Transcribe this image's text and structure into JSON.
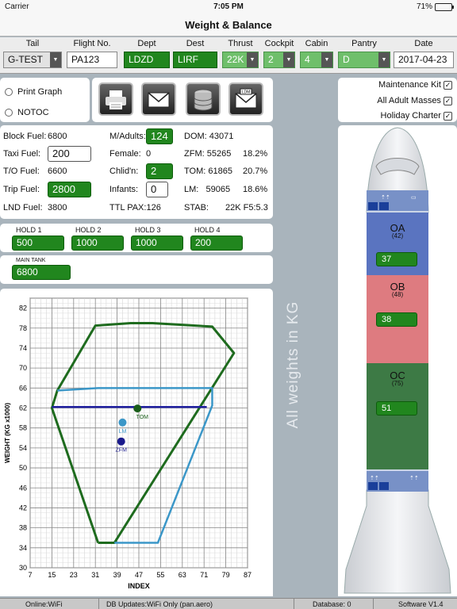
{
  "status": {
    "carrier": "Carrier",
    "time": "7:05 PM",
    "battery": "71%"
  },
  "nav": {
    "title": "Weight & Balance"
  },
  "fields": [
    {
      "label": "Tail",
      "value": "G-TEST"
    },
    {
      "label": "Flight No.",
      "value": "PA123"
    },
    {
      "label": "Dept",
      "value": "LDZD"
    },
    {
      "label": "Dest",
      "value": "LIRF"
    },
    {
      "label": "Thrust",
      "value": "22K"
    },
    {
      "label": "Cockpit",
      "value": "2"
    },
    {
      "label": "Cabin",
      "value": "4"
    },
    {
      "label": "Pantry",
      "value": "D"
    },
    {
      "label": "Date",
      "value": "2017-04-23"
    }
  ],
  "options": {
    "print_graph": "Print Graph",
    "notoc": "NOTOC"
  },
  "side_options": [
    {
      "label": "Maintenance Kit",
      "checked": true
    },
    {
      "label": "All Adult Masses",
      "checked": true
    },
    {
      "label": "Holiday Charter",
      "checked": true
    }
  ],
  "toolbar": {
    "ldm_label": "LDM"
  },
  "fuel": {
    "block_label": "Block Fuel:",
    "block_value": "6800",
    "taxi_label": "Taxi Fuel:",
    "taxi_value": "200",
    "to_label": "T/O Fuel:",
    "to_value": "6600",
    "trip_label": "Trip Fuel:",
    "trip_value": "2800",
    "lnd_label": "LND Fuel:",
    "lnd_value": "3800"
  },
  "pax": {
    "adults_label": "M/Adults:",
    "adults_value": "124",
    "female_label": "Female:",
    "female_value": "0",
    "child_label": "Chlid'n:",
    "child_value": "2",
    "infants_label": "Infants:",
    "infants_value": "0",
    "ttl_label": "TTL PAX:",
    "ttl_value": "126"
  },
  "weights": {
    "dom_label": "DOM:",
    "dom_value": "43071",
    "zfm_label": "ZFM:",
    "zfm_value": "55265",
    "zfm_pct": "18.2%",
    "tom_label": "TOM:",
    "tom_value": "61865",
    "tom_pct": "20.7%",
    "lm_label": "LM:",
    "lm_value": "59065",
    "lm_pct": "18.6%",
    "stab_label": "STAB:",
    "stab_value": "22K F5:5.3"
  },
  "holds": [
    {
      "label": "HOLD 1",
      "value": "500"
    },
    {
      "label": "HOLD 2",
      "value": "1000"
    },
    {
      "label": "HOLD 3",
      "value": "1000"
    },
    {
      "label": "HOLD 4",
      "value": "200"
    }
  ],
  "main_tank": {
    "label": "MAIN TANK",
    "value": "6800"
  },
  "note": "All weights in KG",
  "aircraft": {
    "zones": [
      {
        "name": "OA",
        "count": "(42)",
        "value": "37",
        "color": "#5a74c0"
      },
      {
        "name": "OB",
        "count": "(48)",
        "value": "38",
        "color": "#de7b80"
      },
      {
        "name": "OC",
        "count": "(75)",
        "value": "51",
        "color": "#3d7a45"
      }
    ]
  },
  "chart_data": {
    "type": "line",
    "xlabel": "INDEX",
    "ylabel": "WEIGHT (KG x1000)",
    "x_ticks": [
      7,
      15,
      23,
      31,
      39,
      47,
      55,
      63,
      71,
      79,
      87
    ],
    "y_ticks": [
      30,
      34,
      38,
      42,
      46,
      50,
      54,
      58,
      62,
      66,
      70,
      74,
      78,
      82
    ],
    "xlim": [
      7,
      87
    ],
    "ylim": [
      30,
      84
    ],
    "grid": true,
    "envelopes": [
      {
        "color": "#1e6b1e",
        "points": [
          [
            32,
            35
          ],
          [
            38,
            35
          ],
          [
            82,
            73
          ],
          [
            74,
            78.3
          ],
          [
            52,
            79
          ],
          [
            44,
            79
          ],
          [
            31,
            78.5
          ],
          [
            17,
            65.5
          ],
          [
            15,
            62
          ],
          [
            32,
            35
          ]
        ]
      },
      {
        "color": "#3b97c8",
        "points": [
          [
            17,
            65.5
          ],
          [
            32,
            66
          ],
          [
            74,
            66
          ],
          [
            74,
            62.5
          ],
          [
            54,
            35
          ],
          [
            38,
            35
          ]
        ]
      }
    ],
    "mac_line": {
      "color": "#2020a0",
      "points": [
        [
          15,
          62.2
        ],
        [
          72,
          62.2
        ]
      ]
    },
    "points": [
      {
        "name": "TOM",
        "x": 46.5,
        "y": 61.9,
        "color": "#1a5e1a"
      },
      {
        "name": "LM",
        "x": 41,
        "y": 59.1,
        "color": "#3b97c8"
      },
      {
        "name": "ZFM",
        "x": 40.5,
        "y": 55.3,
        "color": "#1a1a8c"
      }
    ]
  },
  "footer": {
    "online": "Online:WiFi",
    "db_updates": "DB Updates:WiFi Only   (pan.aero)",
    "database": "Database:   0",
    "software": "Software V1.4"
  }
}
